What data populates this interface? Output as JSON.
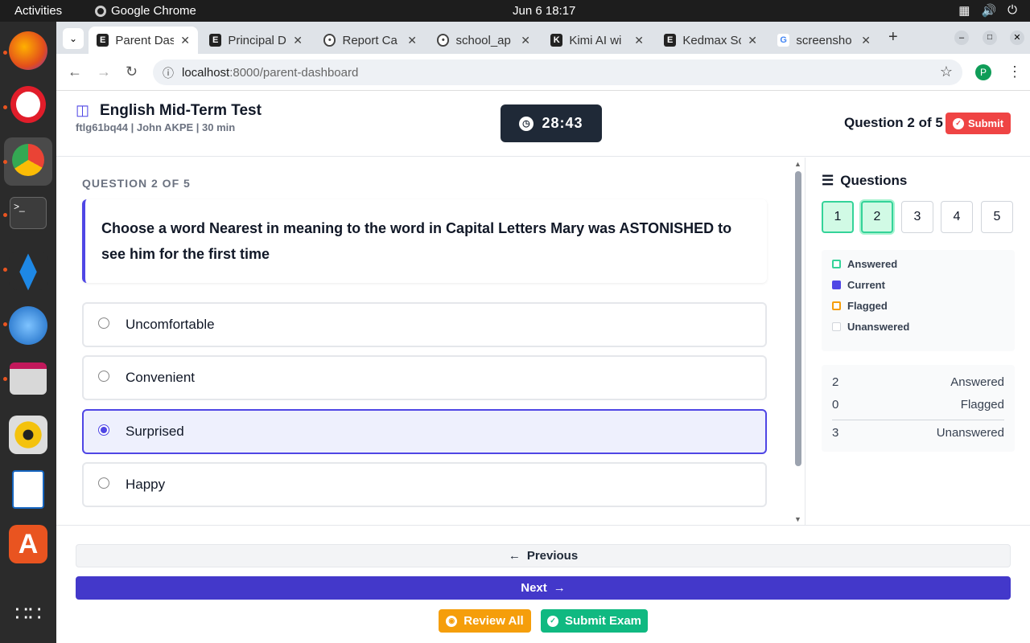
{
  "system": {
    "activities": "Activities",
    "app_name": "Google Chrome",
    "clock": "Jun 6  18:17"
  },
  "browser": {
    "tabs": [
      {
        "label": "Parent Das",
        "favicon": "E",
        "active": true
      },
      {
        "label": "Principal D",
        "favicon": "E"
      },
      {
        "label": "Report Ca",
        "favicon": "globe"
      },
      {
        "label": "school_ap",
        "favicon": "globe"
      },
      {
        "label": "Kimi AI wi",
        "favicon": "K"
      },
      {
        "label": "Kedmax Sc",
        "favicon": "E"
      },
      {
        "label": "screensho",
        "favicon": "G"
      }
    ],
    "url_host": "localhost",
    "url_path": ":8000/parent-dashboard",
    "profile_initial": "P"
  },
  "exam": {
    "title": "English Mid-Term Test",
    "meta": "ftlg61bq44 | John AKPE | 30 min",
    "timer": "28:43",
    "question_count": "Question 2 of 5",
    "submit_label": "Submit"
  },
  "question": {
    "label": "QUESTION 2 OF 5",
    "text": "Choose a word Nearest in meaning to the word in Capital Letters Mary was ASTONISHED to see him for the first time",
    "options": [
      {
        "label": "Uncomfortable",
        "selected": false
      },
      {
        "label": "Convenient",
        "selected": false
      },
      {
        "label": "Surprised",
        "selected": true
      },
      {
        "label": "Happy",
        "selected": false
      }
    ]
  },
  "sidebar": {
    "title": "Questions",
    "numbers": [
      "1",
      "2",
      "3",
      "4",
      "5"
    ],
    "legend": [
      {
        "label": "Answered",
        "color": "#34d399"
      },
      {
        "label": "Current",
        "color": "#4f46e5"
      },
      {
        "label": "Flagged",
        "color": "#f59e0b"
      },
      {
        "label": "Unanswered",
        "color": "#d1d5db"
      }
    ],
    "stats": [
      {
        "value": "2",
        "label": "Answered"
      },
      {
        "value": "0",
        "label": "Flagged"
      },
      {
        "value": "3",
        "label": "Unanswered"
      }
    ]
  },
  "footer": {
    "previous": "Previous",
    "next": "Next",
    "review_all": "Review All",
    "submit_exam": "Submit Exam"
  }
}
